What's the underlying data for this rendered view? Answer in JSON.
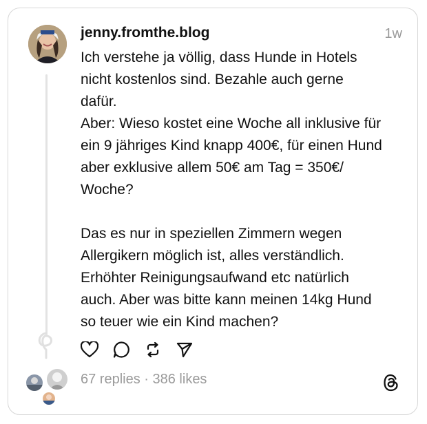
{
  "post": {
    "author": "jenny.fromthe.blog",
    "time": "1w",
    "lines": [
      "Ich verstehe ja völlig, dass Hunde in Hotels",
      "nicht kostenlos sind. Bezahle auch gerne",
      "dafür.",
      "Aber: Wieso kostet eine Woche all inklusive für",
      "ein 9 jähriges Kind knapp 400€, für einen Hund",
      "aber exklusive allem 50€ am Tag = 350€/",
      "Woche?",
      "",
      "Das es nur in speziellen Zimmern wegen",
      "Allergikern möglich ist, alles verständlich.",
      "Erhöhter Reinigungsaufwand etc natürlich",
      "auch. Aber was bitte kann meinen 14kg Hund",
      "so teuer wie ein Kind machen?"
    ]
  },
  "stats": {
    "replies": "67 replies",
    "separator": " · ",
    "likes": "386 likes"
  },
  "icons": {
    "like": "heart-icon",
    "reply": "comment-icon",
    "repost": "repost-icon",
    "share": "send-icon",
    "brand": "threads-logo-icon"
  }
}
